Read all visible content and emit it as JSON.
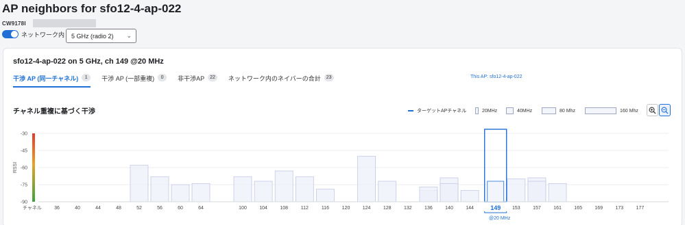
{
  "page": {
    "title": "AP neighbors for sfo12-4-ap-022",
    "serial_label": "CW9178I",
    "toggle_label": "ネットワーク内",
    "toggle_on": true,
    "radio_select": "5 GHz (radio 2)"
  },
  "card": {
    "title": "sfo12-4-ap-022 on 5 GHz, ch 149 @20 MHz",
    "tabs": [
      {
        "label": "干渉 AP (同一チャネル)",
        "count": "1",
        "active": true
      },
      {
        "label": "干渉 AP (一部重複)",
        "count": "0",
        "active": false
      },
      {
        "label": "非干渉AP",
        "count": "22",
        "active": false
      },
      {
        "label": "ネットワーク内のネイバーの合計",
        "count": "23",
        "active": false
      }
    ],
    "section_title": "チャネル重複に基づく干渉",
    "legend": {
      "target": "ターゲットAPチャネル",
      "w20": "20MHz",
      "w40": "40MHz",
      "w80": "80 Mhz",
      "w160": "160 Mhz"
    },
    "zoom_in_icon": "zoom-in-icon",
    "zoom_out_icon": "zoom-out-icon"
  },
  "chart_data": {
    "type": "bar",
    "ylabel": "RSSI",
    "xlabel": "チャネル",
    "ylim": [
      -90,
      -30
    ],
    "yticks": [
      "-30",
      "-45",
      "-60",
      "-75",
      "-90"
    ],
    "categories": [
      "36",
      "40",
      "44",
      "48",
      "52",
      "56",
      "60",
      "64",
      "100",
      "104",
      "108",
      "112",
      "116",
      "120",
      "124",
      "128",
      "132",
      "136",
      "140",
      "144",
      "149",
      "153",
      "157",
      "161",
      "165",
      "169",
      "173",
      "177"
    ],
    "target_channel": "149",
    "target_annotation": "This AP: sfo12-4-ap-022",
    "target_width_label": "@20 MHz",
    "colors": {
      "target": "#1f6fd6",
      "neighbor_fill": "#eef0fa",
      "neighbor_stroke": "#c3c8e6"
    },
    "neighbors": [
      {
        "channel": "52",
        "rssi": -58
      },
      {
        "channel": "56",
        "rssi": -68
      },
      {
        "channel": "60",
        "rssi": -75
      },
      {
        "channel": "64",
        "rssi": -74
      },
      {
        "channel": "100",
        "rssi": -68
      },
      {
        "channel": "104",
        "rssi": -72
      },
      {
        "channel": "108",
        "rssi": -63
      },
      {
        "channel": "112",
        "rssi": -68
      },
      {
        "channel": "116",
        "rssi": -79
      },
      {
        "channel": "124",
        "rssi": -50
      },
      {
        "channel": "128",
        "rssi": -72
      },
      {
        "channel": "136",
        "rssi": -80
      },
      {
        "channel": "136",
        "rssi": -77
      },
      {
        "channel": "140",
        "rssi": -69
      },
      {
        "channel": "140",
        "rssi": -74
      },
      {
        "channel": "144",
        "rssi": -80
      },
      {
        "channel": "153",
        "rssi": -70
      },
      {
        "channel": "157",
        "rssi": -69
      },
      {
        "channel": "157",
        "rssi": -72
      },
      {
        "channel": "161",
        "rssi": -74
      }
    ],
    "target": {
      "channel": "149",
      "rssi": -72
    }
  }
}
